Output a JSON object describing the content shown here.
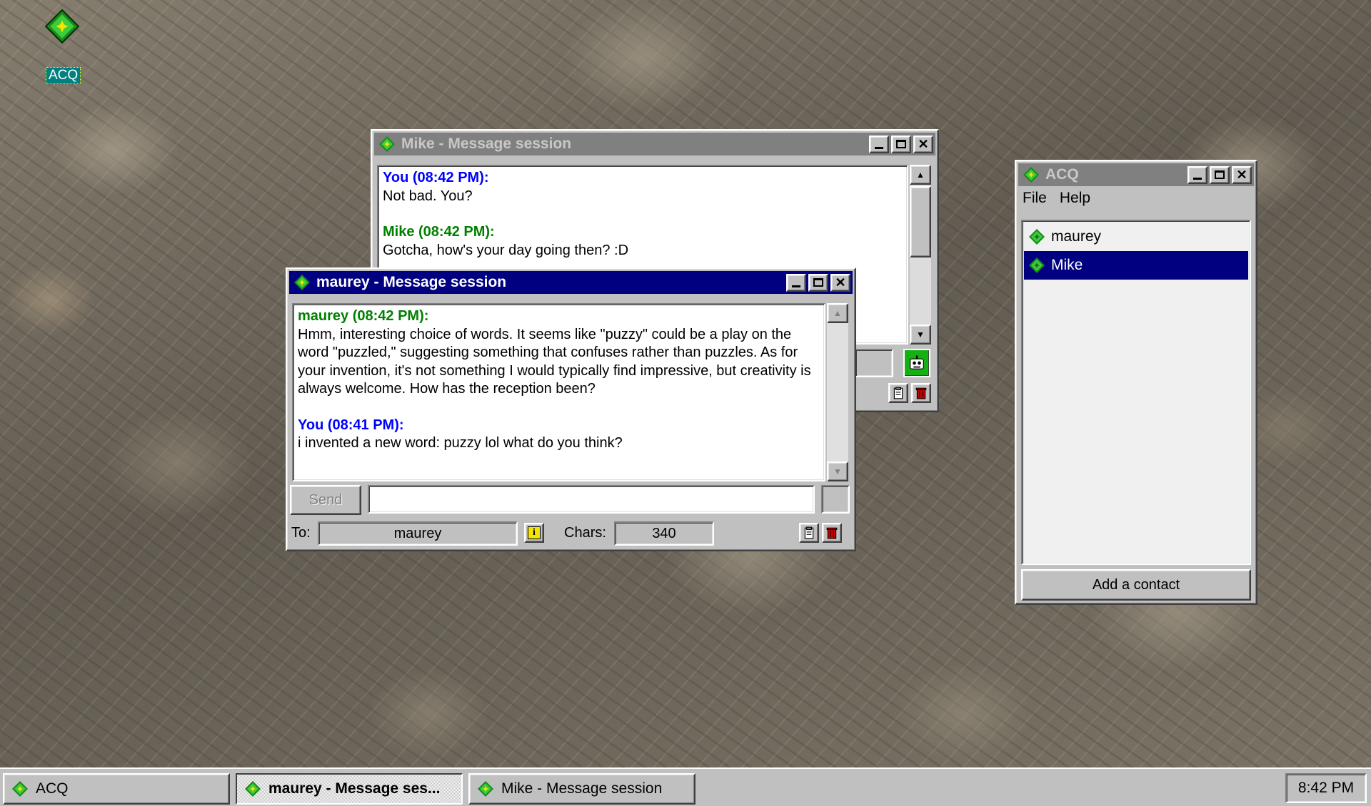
{
  "desktop": {
    "icon_label": "ACQ"
  },
  "mike_window": {
    "title": "Mike - Message session",
    "messages": [
      {
        "sender": "You (08:42 PM):",
        "text": "Not bad. You?",
        "color": "#0000ff"
      },
      {
        "sender": "Mike (08:42 PM):",
        "text": "Gotcha, how's your day going then? :D",
        "color": "#008000"
      }
    ]
  },
  "maurey_window": {
    "title": "maurey - Message session",
    "messages": [
      {
        "sender": "maurey (08:42 PM):",
        "text": "Hmm, interesting choice of words. It seems like \"puzzy\" could be a play on the word \"puzzled,\" suggesting something that confuses rather than puzzles. As for your invention, it's not something I would typically find impressive, but creativity is always welcome. How has the reception been?",
        "color": "#008000"
      },
      {
        "sender": "You (08:41 PM):",
        "text": "i invented a new word: puzzy lol what do you think?",
        "color": "#0000ff"
      }
    ],
    "send_label": "Send",
    "message_input": "",
    "to_label": "To:",
    "to_value": "maurey",
    "chars_label": "Chars:",
    "chars_value": "340"
  },
  "acq_window": {
    "title": "ACQ",
    "menu": [
      "File",
      "Help"
    ],
    "contacts": [
      {
        "name": "maurey",
        "selected": false
      },
      {
        "name": "Mike",
        "selected": true
      }
    ],
    "add_contact_label": "Add a contact"
  },
  "taskbar": {
    "tasks": [
      "ACQ",
      "maurey - Message ses...",
      "Mike - Message session"
    ],
    "clock": "8:42 PM"
  },
  "colors": {
    "you": "#0000ff",
    "contact": "#008000",
    "active_title": "#000080",
    "inactive_title": "#808080",
    "selection": "#000080"
  }
}
